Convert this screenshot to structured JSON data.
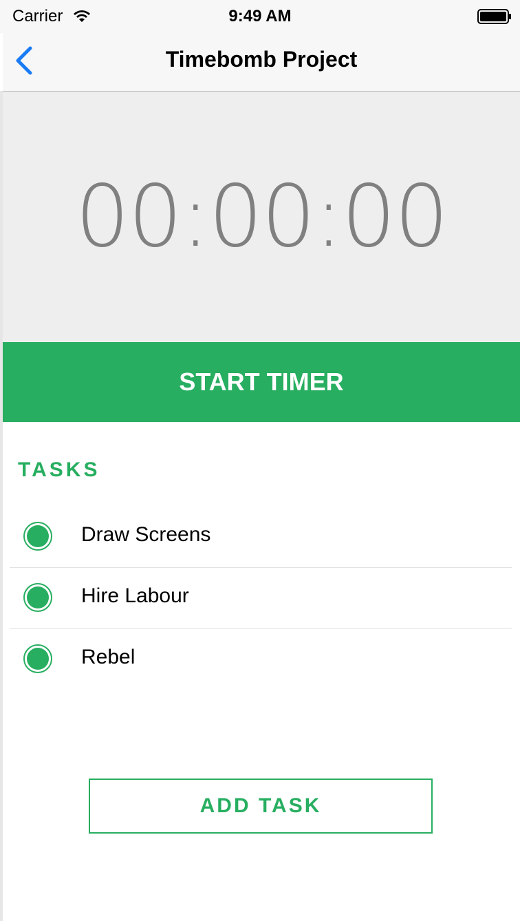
{
  "status_bar": {
    "carrier": "Carrier",
    "time": "9:49 AM",
    "wifi_icon": "wifi-icon",
    "battery_icon": "battery-full-icon"
  },
  "nav": {
    "back_icon": "chevron-left-icon",
    "title": "Timebomb Project"
  },
  "timer": {
    "display": "00:00:00",
    "start_label": "START TIMER"
  },
  "tasks": {
    "header": "TASKS",
    "items": [
      {
        "label": "Draw Screens",
        "icon": "task-status-dot-icon"
      },
      {
        "label": "Hire Labour",
        "icon": "task-status-dot-icon"
      },
      {
        "label": "Rebel",
        "icon": "task-status-dot-icon"
      }
    ],
    "add_label": "ADD TASK"
  },
  "colors": {
    "accent": "#27ae60",
    "ios_blue": "#1a7cf5",
    "timer_bg": "#eeeeee",
    "timer_text": "#808080"
  }
}
